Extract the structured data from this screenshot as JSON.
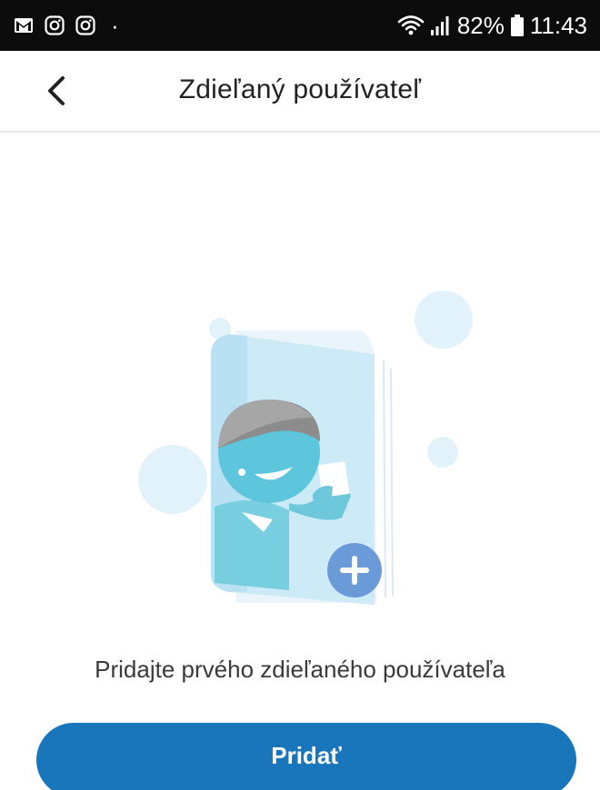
{
  "status_bar": {
    "battery": "82%",
    "time": "11:43",
    "dot": "·",
    "icons_left": [
      "gmail-icon",
      "instagram-icon",
      "instagram-icon"
    ],
    "icons_right": [
      "wifi-icon",
      "signal-icon",
      "battery-icon"
    ]
  },
  "header": {
    "title": "Zdieľaný používateľ",
    "back_icon": "chevron-left-icon"
  },
  "empty_state": {
    "message": "Pridajte prvého zdieľaného používateľa",
    "illustration_icon": "shared-user-book-icon"
  },
  "actions": {
    "add_label": "Pridať"
  },
  "colors": {
    "status_bar_bg": "#0c0c0c",
    "primary": "#1a76bb",
    "illustration_light": "#d8eefa",
    "illustration_face": "#5ec6dc",
    "illustration_plus": "#6b9ad8"
  }
}
